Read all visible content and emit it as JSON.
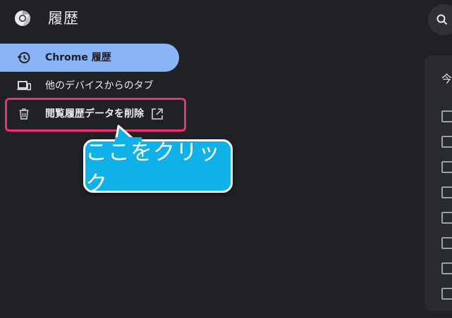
{
  "header": {
    "title": "履歴",
    "logo_icon": "chrome-logo-icon",
    "search_icon": "search-icon"
  },
  "sidebar": {
    "items": [
      {
        "label": "Chrome 履歴",
        "icon": "history-icon",
        "active": true
      },
      {
        "label": "他のデバイスからのタブ",
        "icon": "devices-icon",
        "active": false
      },
      {
        "label": "閲覧履歴データを削除",
        "icon": "trash-icon",
        "trailing_icon": "open-in-new-icon",
        "active": false
      }
    ]
  },
  "callout": {
    "text": "ここをクリック"
  },
  "main": {
    "heading": "今",
    "checkbox_count": 8
  },
  "colors": {
    "background": "#202124",
    "active_item": "#8ab4f8",
    "highlight_border": "#e8336f",
    "callout_fill": "#10b1e8"
  }
}
